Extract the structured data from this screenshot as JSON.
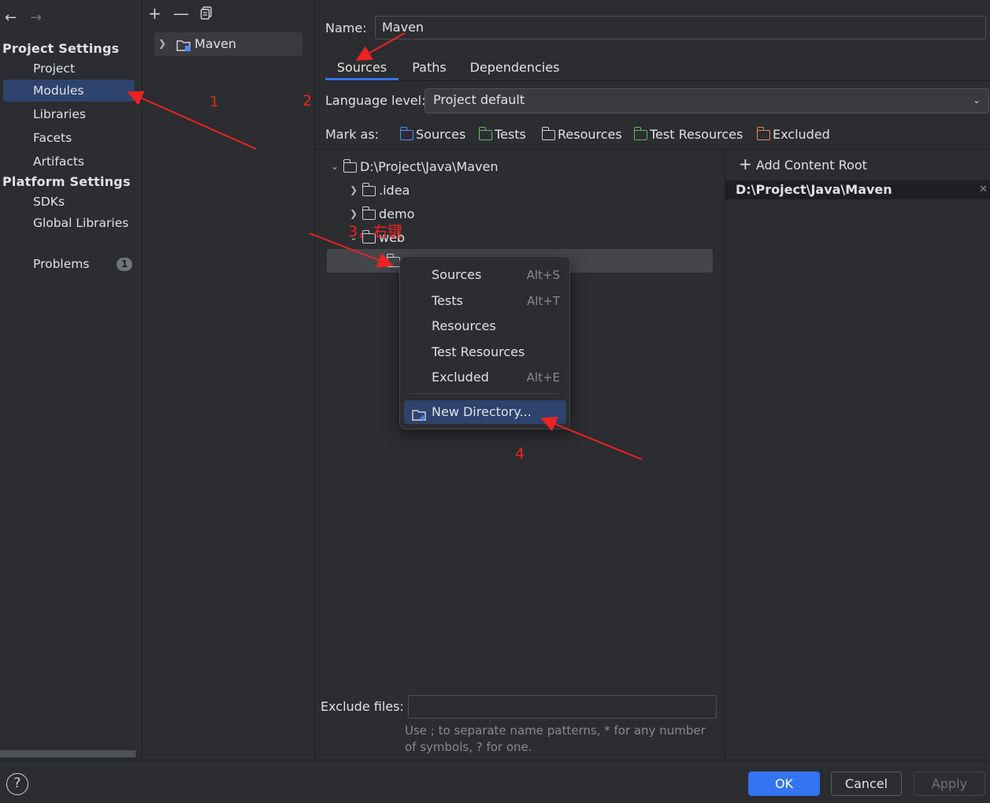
{
  "sidebar": {
    "sections": [
      {
        "title": "Project Settings",
        "items": [
          "Project",
          "Modules",
          "Libraries",
          "Facets",
          "Artifacts"
        ]
      },
      {
        "title": "Platform Settings",
        "items": [
          "SDKs",
          "Global Libraries"
        ]
      }
    ],
    "selected": "Modules",
    "problems_label": "Problems",
    "problems_count": "1"
  },
  "module_tree": {
    "toolbar_icons": [
      "add-icon",
      "remove-icon",
      "copy-icon"
    ],
    "module_name": "Maven"
  },
  "main": {
    "name_label": "Name:",
    "name_value": "Maven",
    "tabs": [
      "Sources",
      "Paths",
      "Dependencies"
    ],
    "active_tab": "Sources",
    "language_level_label": "Language level:",
    "language_level_value": "Project default",
    "mark_as_label": "Mark as:",
    "mark_as": [
      {
        "label": "Sources",
        "icon": "sources-folder-icon",
        "color": "#548af7"
      },
      {
        "label": "Tests",
        "icon": "tests-folder-icon",
        "color": "#5fb865"
      },
      {
        "label": "Resources",
        "icon": "resources-folder-icon",
        "color": "#ced0d6"
      },
      {
        "label": "Test Resources",
        "icon": "test-resources-folder-icon",
        "color": "#5fb865"
      },
      {
        "label": "Excluded",
        "icon": "excluded-folder-icon",
        "color": "#e08855"
      }
    ],
    "tree": {
      "root": "D:\\Project\\Java\\Maven",
      "children": [
        ".idea",
        "demo",
        "web"
      ]
    },
    "exclude_files_label": "Exclude files:",
    "exclude_files_value": "",
    "exclude_hint_line1": "Use ; to separate name patterns, * for any number",
    "exclude_hint_line2": "of symbols, ? for one."
  },
  "content_root": {
    "add_label": "Add Content Root",
    "path": "D:\\Project\\Java\\Maven"
  },
  "context_menu": {
    "items": [
      {
        "label": "Sources",
        "shortcut": "Alt+S"
      },
      {
        "label": "Tests",
        "shortcut": "Alt+T"
      },
      {
        "label": "Resources",
        "shortcut": ""
      },
      {
        "label": "Test Resources",
        "shortcut": ""
      },
      {
        "label": "Excluded",
        "shortcut": "Alt+E"
      }
    ],
    "new_directory": "New Directory..."
  },
  "footer": {
    "help": "?",
    "ok": "OK",
    "cancel": "Cancel",
    "apply": "Apply"
  },
  "annotations": {
    "n1": "1",
    "n2": "2",
    "n3": "3，右键",
    "n4": "4",
    "color": "#ee2222"
  },
  "colors": {
    "accent": "#3574f0",
    "selection": "#2e436e",
    "background": "#2b2d30"
  }
}
